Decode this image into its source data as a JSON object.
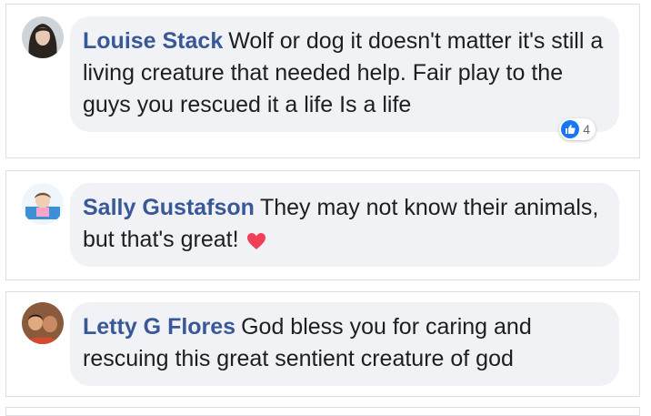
{
  "colors": {
    "author": "#385898",
    "text": "#1c1e21",
    "bubble": "#f0f2f5",
    "border": "#dddfe2",
    "like_blue": "#1877f2",
    "heart_red": "#f33e58"
  },
  "comments": [
    {
      "author": "Louise Stack",
      "text": "Wolf or dog it doesn't matter it's still a living creature that needed help. Fair play to the guys you rescued it a life Is a life",
      "reaction_icon": "like-icon",
      "reaction_count": "4"
    },
    {
      "author": "Sally Gustafson",
      "text": "They may not know their animals, but that's great!",
      "emoji": "heart-icon"
    },
    {
      "author": "Letty G Flores",
      "text": "God bless you for caring and rescuing this great sentient creature of god"
    }
  ]
}
